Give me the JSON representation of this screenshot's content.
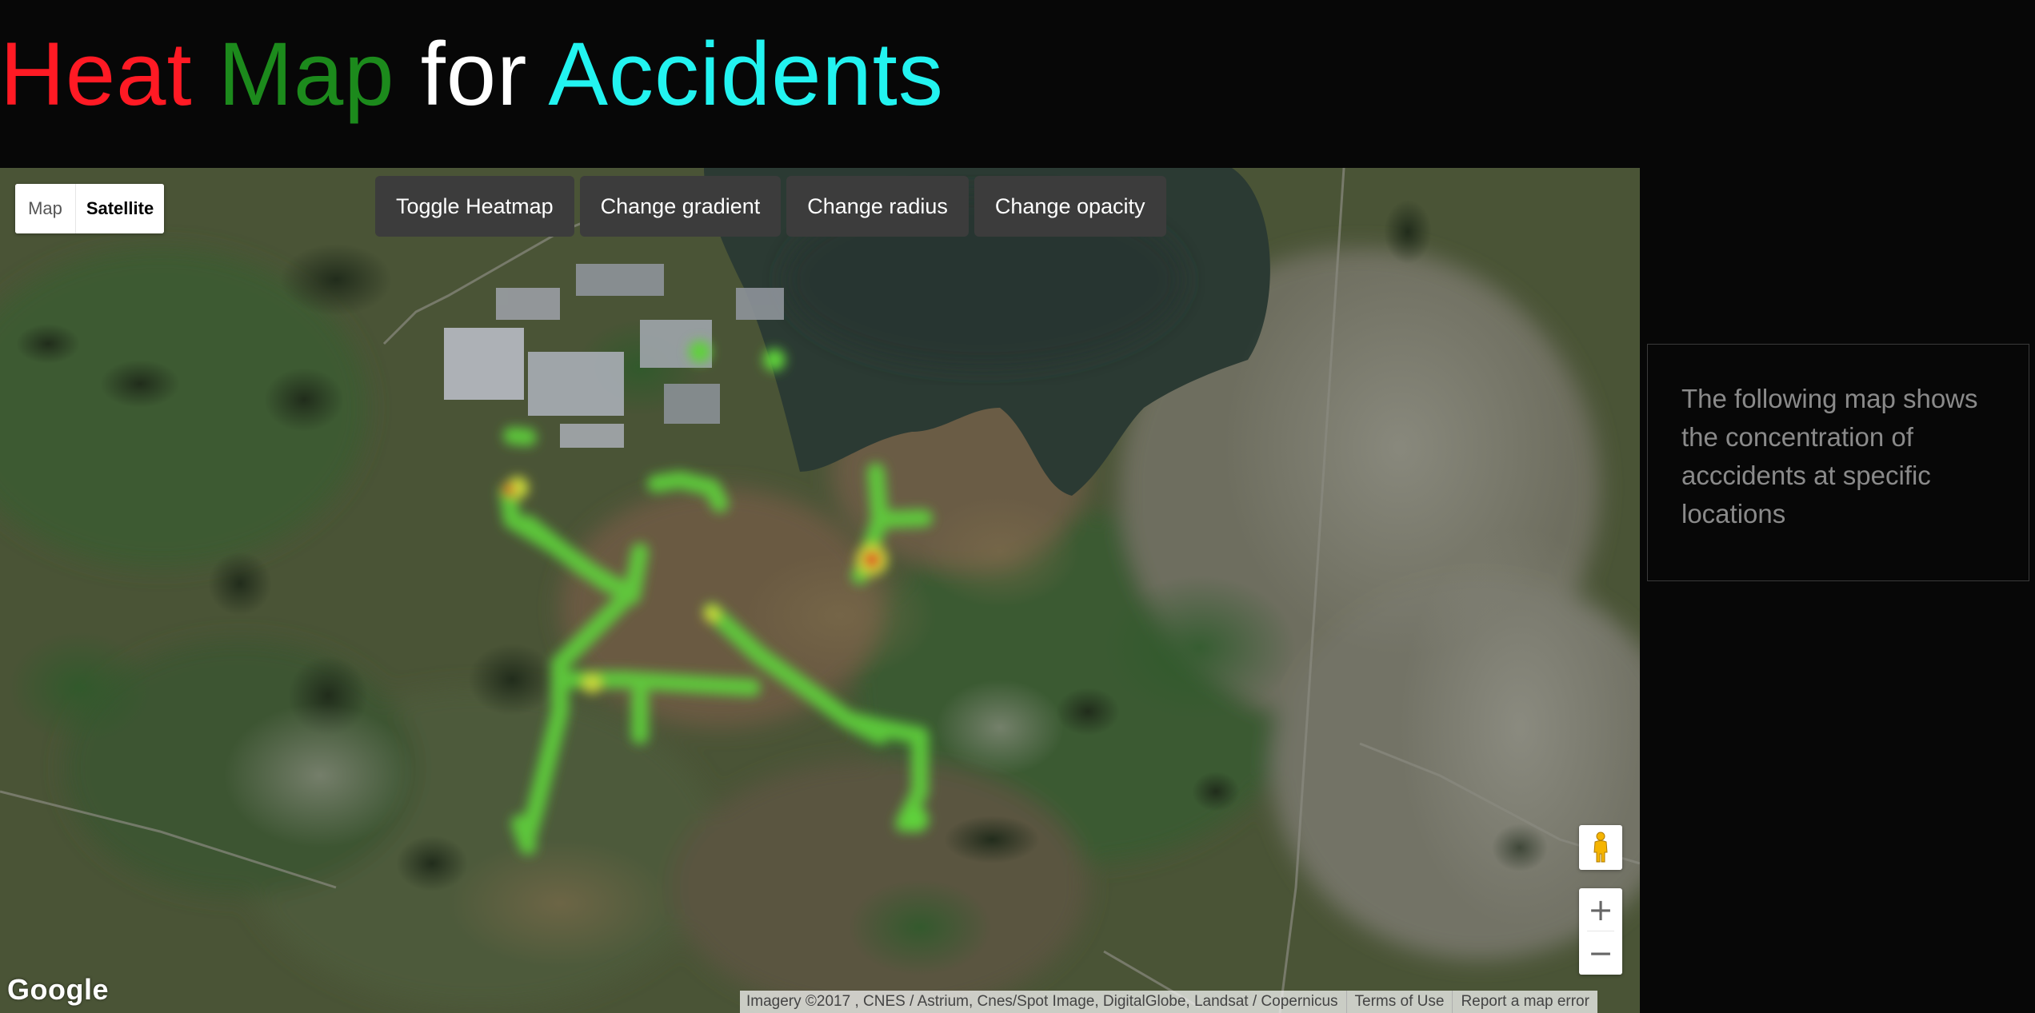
{
  "title": {
    "word_heat": "Heat",
    "word_map": "Map",
    "word_for": "for",
    "word_accidents": "Accidents",
    "colors": {
      "heat": "#ff1a24",
      "map": "#1c8a1c",
      "for": "#ffffff",
      "accidents": "#22f3f0"
    }
  },
  "map": {
    "type_control": {
      "map_label": "Map",
      "satellite_label": "Satellite",
      "selected": "Satellite"
    },
    "floating_panel": {
      "toggle_heatmap": "Toggle Heatmap",
      "change_gradient": "Change gradient",
      "change_radius": "Change radius",
      "change_opacity": "Change opacity"
    },
    "controls": {
      "pegman_icon": "pegman-icon",
      "zoom_in": "+",
      "zoom_out": "−"
    },
    "logo": "Google",
    "attribution": {
      "imagery": "Imagery ©2017 , CNES / Astrium, Cnes/Spot Image, DigitalGlobe, Landsat / Copernicus",
      "terms": "Terms of Use",
      "report": "Report a map error"
    },
    "heatmap_colors": {
      "low": "#5fd23a",
      "mid": "#c8d83a",
      "high": "#e0241c"
    }
  },
  "info_panel": {
    "text": "The following map shows the concentration of acccidents at specific locations"
  }
}
